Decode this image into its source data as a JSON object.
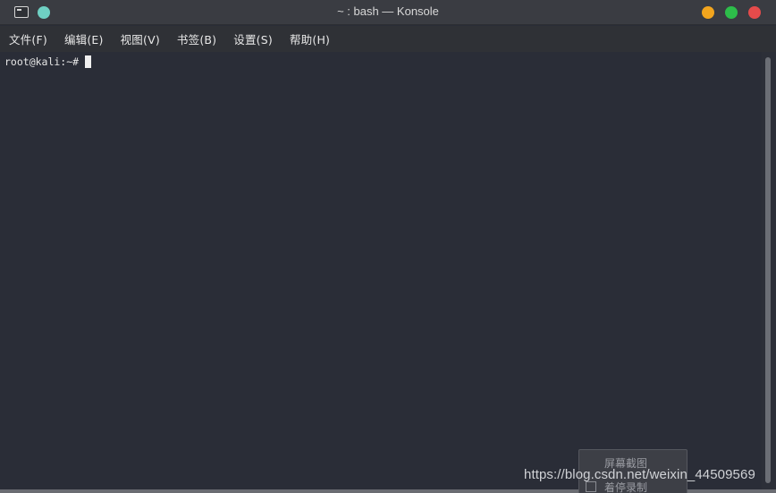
{
  "window": {
    "title": "~ : bash — Konsole"
  },
  "menubar": {
    "items": [
      {
        "label": "文件(F)"
      },
      {
        "label": "编辑(E)"
      },
      {
        "label": "视图(V)"
      },
      {
        "label": "书签(B)"
      },
      {
        "label": "设置(S)"
      },
      {
        "label": "帮助(H)"
      }
    ]
  },
  "terminal": {
    "prompt": "root@kali:~#"
  },
  "popup": {
    "item_1": "屏幕截图",
    "item_2": "着停录制"
  },
  "watermark": {
    "text": "https://blog.csdn.net/weixin_44509569"
  },
  "colors": {
    "pin": "#6fd0c3",
    "minimize": "#f2a51e",
    "maximize": "#2dbd4a",
    "close": "#e54b4b",
    "terminal_bg": "#2a2d37"
  },
  "icons": {
    "app": "konsole-terminal-icon",
    "pin": "keep-on-top-icon",
    "minimize": "minimize-icon",
    "maximize": "maximize-icon",
    "close": "close-icon"
  }
}
